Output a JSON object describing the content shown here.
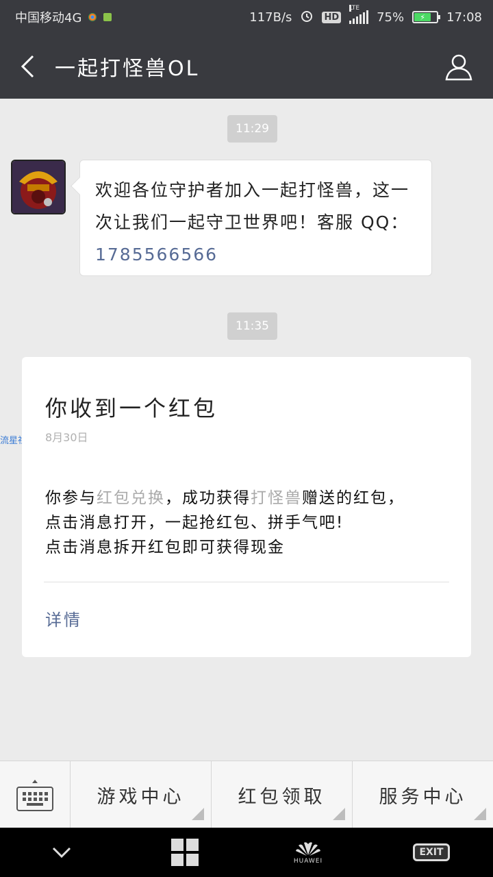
{
  "status_bar": {
    "carrier": "中国移动4G",
    "speed": "117B/s",
    "hd": "HD",
    "network": "LTE",
    "battery": "75%",
    "time": "17:08"
  },
  "header": {
    "title": "一起打怪兽OL"
  },
  "messages": {
    "time1": "11:29",
    "welcome_text": "欢迎各位守护者加入一起打怪兽，这一次让我们一起守卫世界吧！客服 QQ：",
    "qq_number": "1785566566",
    "time2": "11:35"
  },
  "card": {
    "title": "你收到一个红包",
    "date": "8月30日",
    "line1_a": "你参与",
    "line1_b": "红包兑换",
    "line1_c": "，成功获得",
    "line1_d": "打怪兽",
    "line1_e": "赠送的红包，",
    "line2": "点击消息打开，一起抢红包、拼手气吧!",
    "line3": "点击消息拆开红包即可获得现金",
    "detail_link": "详情"
  },
  "watermark": "流星社区",
  "menu": {
    "items": [
      {
        "label": "游戏中心"
      },
      {
        "label": "红包领取"
      },
      {
        "label": "服务中心"
      }
    ]
  },
  "nav": {
    "brand": "HUAWEI",
    "exit": "EXIT"
  },
  "colors": {
    "title_bar": "#393a3f",
    "link": "#576b95",
    "background": "#ebebeb"
  }
}
